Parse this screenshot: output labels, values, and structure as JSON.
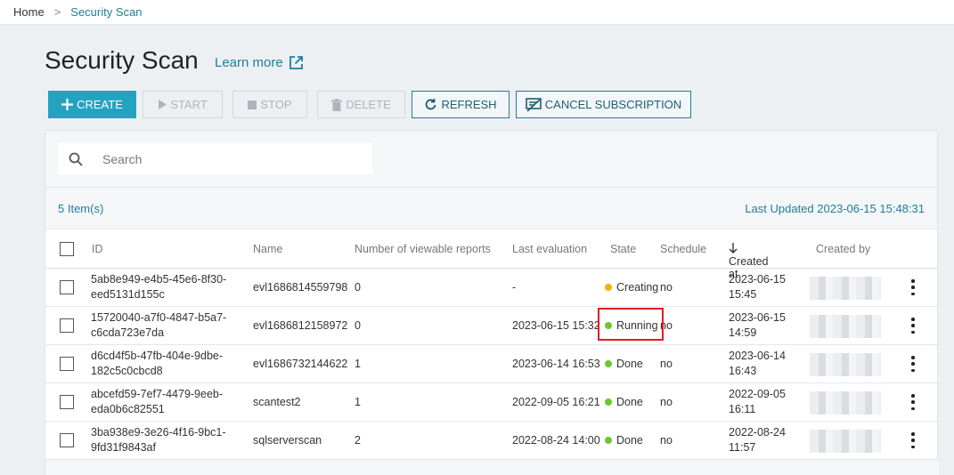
{
  "breadcrumb": {
    "home": "Home",
    "separator": ">",
    "current": "Security Scan"
  },
  "page": {
    "title": "Security Scan",
    "learn_more": "Learn more"
  },
  "toolbar": {
    "create": "CREATE",
    "start": "START",
    "stop": "STOP",
    "delete": "DELETE",
    "refresh": "REFRESH",
    "cancel_subscription": "CANCEL SUBSCRIPTION"
  },
  "search": {
    "placeholder": "Search"
  },
  "info": {
    "item_count": "5 Item(s)",
    "last_updated": "Last Updated 2023-06-15 15:48:31"
  },
  "table": {
    "headers": {
      "id": "ID",
      "name": "Name",
      "reports": "Number of viewable reports",
      "last_eval": "Last evaluation",
      "state": "State",
      "schedule": "Schedule",
      "created_at": "Created at",
      "created_by": "Created by"
    },
    "rows": [
      {
        "id1": "5ab8e949-e4b5-45e6-8f30-",
        "id2": "eed5131d155c",
        "name": "evl1686814559798",
        "reports": "0",
        "last_eval": "-",
        "state": "Creating",
        "state_color": "#f0b400",
        "schedule": "no",
        "created1": "2023-06-15",
        "created2": "15:45"
      },
      {
        "id1": "15720040-a7f0-4847-b5a7-",
        "id2": "c6cda723e7da",
        "name": "evl1686812158972",
        "reports": "0",
        "last_eval": "2023-06-15 15:32",
        "state": "Running",
        "state_color": "#6cc72a",
        "schedule": "no",
        "created1": "2023-06-15",
        "created2": "14:59"
      },
      {
        "id1": "d6cd4f5b-47fb-404e-9dbe-",
        "id2": "182c5c0cbcd8",
        "name": "evl1686732144622",
        "reports": "1",
        "last_eval": "2023-06-14 16:53",
        "state": "Done",
        "state_color": "#6cc72a",
        "schedule": "no",
        "created1": "2023-06-14",
        "created2": "16:43"
      },
      {
        "id1": "abcefd59-7ef7-4479-9eeb-",
        "id2": "eda0b6c82551",
        "name": "scantest2",
        "reports": "1",
        "last_eval": "2022-09-05 16:21",
        "state": "Done",
        "state_color": "#6cc72a",
        "schedule": "no",
        "created1": "2022-09-05",
        "created2": "16:11"
      },
      {
        "id1": "3ba938e9-3e26-4f16-9bc1-",
        "id2": "9fd31f9843af",
        "name": "sqlserverscan",
        "reports": "2",
        "last_eval": "2022-08-24 14:00",
        "state": "Done",
        "state_color": "#6cc72a",
        "schedule": "no",
        "created1": "2022-08-24",
        "created2": "11:57"
      }
    ]
  },
  "colors": {
    "accent": "#24a3c1",
    "link": "#1d7f9a",
    "highlight": "#e01c24"
  }
}
